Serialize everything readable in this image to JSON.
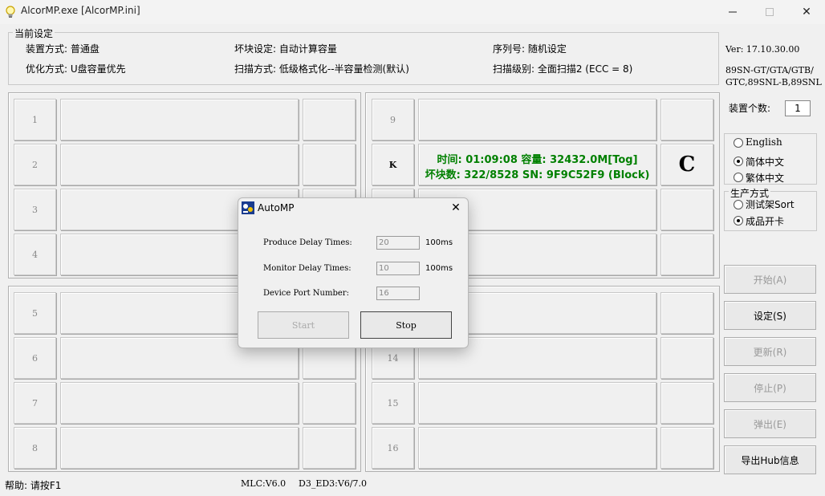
{
  "window": {
    "title": "AlcorMP.exe [AlcorMP.ini]",
    "close": "✕"
  },
  "settings": {
    "group_label": "当前设定",
    "install_mode": "装置方式: 普通盘",
    "bad_block": "坏块设定: 自动计算容量",
    "serial": "序列号: 随机设定",
    "optimize": "优化方式: U盘容量优先",
    "scan_mode": "扫描方式: 低级格式化--半容量检测(默认)",
    "scan_level": "扫描级别: 全面扫描2 (ECC = 8)"
  },
  "version": {
    "ver": "Ver: 17.10.30.00",
    "chips_line1": "89SN-GT/GTA/GTB/",
    "chips_line2": "GTC,89SNL-B,89SNL"
  },
  "device_count": {
    "label": "装置个数:",
    "value": "1"
  },
  "language": {
    "options": [
      "English",
      "简体中文",
      "繁体中文"
    ],
    "selected": 1
  },
  "production": {
    "label": "生产方式",
    "options": [
      "测试架Sort",
      "成品开卡"
    ],
    "selected": 1
  },
  "buttons": {
    "start": "开始(A)",
    "settings": "设定(S)",
    "update": "更新(R)",
    "stop": "停止(P)",
    "eject": "弹出(E)",
    "export": "导出Hub信息"
  },
  "ports": {
    "p1": "1",
    "p2": "2",
    "p3": "3",
    "p4": "4",
    "p5": "5",
    "p6": "6",
    "p7": "7",
    "p8": "8",
    "p9": "9",
    "pk": "K",
    "p14": "14",
    "p15": "15",
    "p16": "16"
  },
  "port_k_status": {
    "line1": "时间: 01:09:08 容量: 32432.0M[Tog]",
    "line2": "坏块数: 322/8528 SN: 9F9C52F9 (Block)",
    "grade": "C"
  },
  "statusbar": {
    "help": "帮助: 请按F1",
    "mlc": "MLC:V6.0",
    "ed3": "D3_ED3:V6/7.0"
  },
  "dialog": {
    "title": "AutoMP",
    "close": "✕",
    "produce_label": "Produce Delay Times:",
    "produce_value": "20",
    "produce_unit": "100ms",
    "monitor_label": "Monitor Delay Times:",
    "monitor_value": "10",
    "monitor_unit": "100ms",
    "port_label": "Device Port Number:",
    "port_value": "16",
    "start": "Start",
    "stop": "Stop"
  },
  "colors": {
    "status_green": "#008000"
  }
}
